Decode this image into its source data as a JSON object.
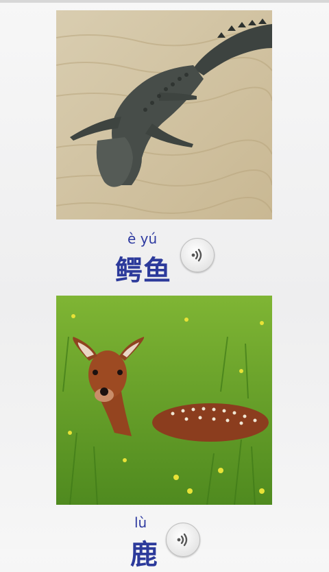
{
  "cards": [
    {
      "pinyin": "è yú",
      "hanzi": "鳄鱼",
      "image_icon": "crocodile-photo",
      "sound_icon": "speaker-icon"
    },
    {
      "pinyin": "lù",
      "hanzi": "鹿",
      "image_icon": "deer-photo",
      "sound_icon": "speaker-icon"
    }
  ],
  "colors": {
    "text_accent": "#2c3a9b",
    "background": "#f2f2f3"
  }
}
